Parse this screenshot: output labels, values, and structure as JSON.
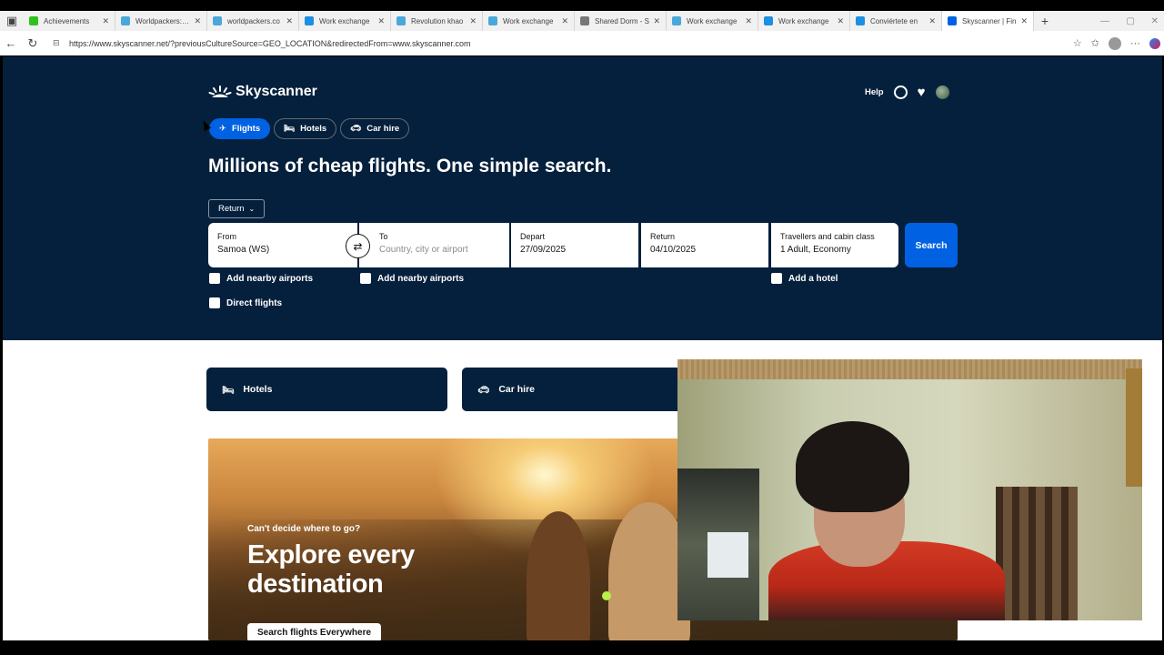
{
  "browser": {
    "tabs": [
      {
        "title": "Achievements",
        "color": "#31c11f"
      },
      {
        "title": "Worldpackers: W",
        "color": "#4aa8d8"
      },
      {
        "title": "worldpackers.co",
        "color": "#4aa8d8"
      },
      {
        "title": "Work exchange",
        "color": "#1d8fe0"
      },
      {
        "title": "Revolution khao",
        "color": "#4aa8d8"
      },
      {
        "title": "Work exchange",
        "color": "#4aa8d8"
      },
      {
        "title": "Shared Dorm - S",
        "color": "#777777"
      },
      {
        "title": "Work exchange",
        "color": "#4aa8d8"
      },
      {
        "title": "Work exchange",
        "color": "#1d8fe0"
      },
      {
        "title": "Conviértete en",
        "color": "#1d8fe0"
      },
      {
        "title": "Skyscanner | Fin",
        "color": "#0062e3"
      }
    ],
    "url": "https://www.skyscanner.net/?previousCultureSource=GEO_LOCATION&redirectedFrom=www.skyscanner.com"
  },
  "site": {
    "brand": "Skyscanner",
    "help_label": "Help",
    "nav_pills": [
      "Flights",
      "Hotels",
      "Car hire"
    ],
    "headline": "Millions of cheap flights. One simple search.",
    "trip_type": "Return",
    "search": {
      "from_label": "From",
      "from_value": "Samoa (WS)",
      "to_label": "To",
      "to_placeholder": "Country, city or airport",
      "depart_label": "Depart",
      "depart_value": "27/09/2025",
      "return_label": "Return",
      "return_value": "04/10/2025",
      "travellers_label": "Travellers and cabin class",
      "travellers_value": "1 Adult, Economy",
      "search_button": "Search"
    },
    "checkboxes": {
      "from_nearby": "Add nearby airports",
      "to_nearby": "Add nearby airports",
      "add_hotel": "Add a hotel",
      "direct": "Direct flights"
    },
    "cards": {
      "hotels": "Hotels",
      "car_hire": "Car hire"
    },
    "promo": {
      "kicker": "Can't decide where to go?",
      "title": "Explore every destination",
      "button": "Search flights Everywhere"
    }
  },
  "colors": {
    "hero_bg": "#05203c",
    "accent": "#0062e3"
  }
}
